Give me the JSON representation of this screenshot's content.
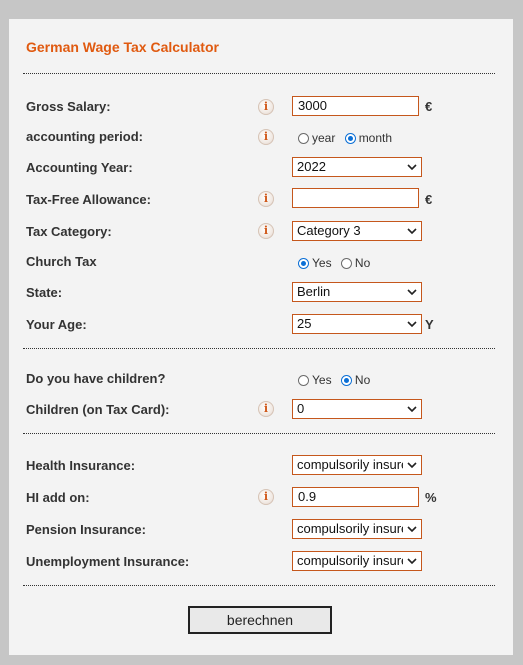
{
  "title": "German Wage Tax Calculator",
  "info_icon_glyph": "i",
  "colors": {
    "accent": "#e05a10",
    "field_border": "#c5571c",
    "radio_selected": "#0b6fd6"
  },
  "gross_salary": {
    "label": "Gross Salary:",
    "value": "3000",
    "unit": "€"
  },
  "accounting_period": {
    "label": "accounting period:",
    "option_year": "year",
    "option_month": "month",
    "selected": "month"
  },
  "accounting_year": {
    "label": "Accounting Year:",
    "value": "2022"
  },
  "tax_free_allowance": {
    "label": "Tax-Free Allowance:",
    "value": "",
    "unit": "€"
  },
  "tax_category": {
    "label": "Tax Category:",
    "value": "Category 3"
  },
  "church_tax": {
    "label": "Church Tax",
    "option_yes": "Yes",
    "option_no": "No",
    "selected": "Yes"
  },
  "state": {
    "label": "State:",
    "value": "Berlin"
  },
  "age": {
    "label": "Your Age:",
    "value": "25",
    "unit": "Y"
  },
  "children": {
    "label": "Do you have children?",
    "option_yes": "Yes",
    "option_no": "No",
    "selected": "No"
  },
  "children_on_card": {
    "label": "Children (on Tax Card):",
    "value": "0"
  },
  "health_insurance": {
    "label": "Health Insurance:",
    "value": "compulsorily insured"
  },
  "hi_add_on": {
    "label": "HI add on:",
    "value": "0.9",
    "unit": "%"
  },
  "pension_insurance": {
    "label": "Pension Insurance:",
    "value": "compulsorily insured"
  },
  "unemployment_insurance": {
    "label": "Unemployment Insurance:",
    "value": "compulsorily insured"
  },
  "submit_label": "berechnen"
}
